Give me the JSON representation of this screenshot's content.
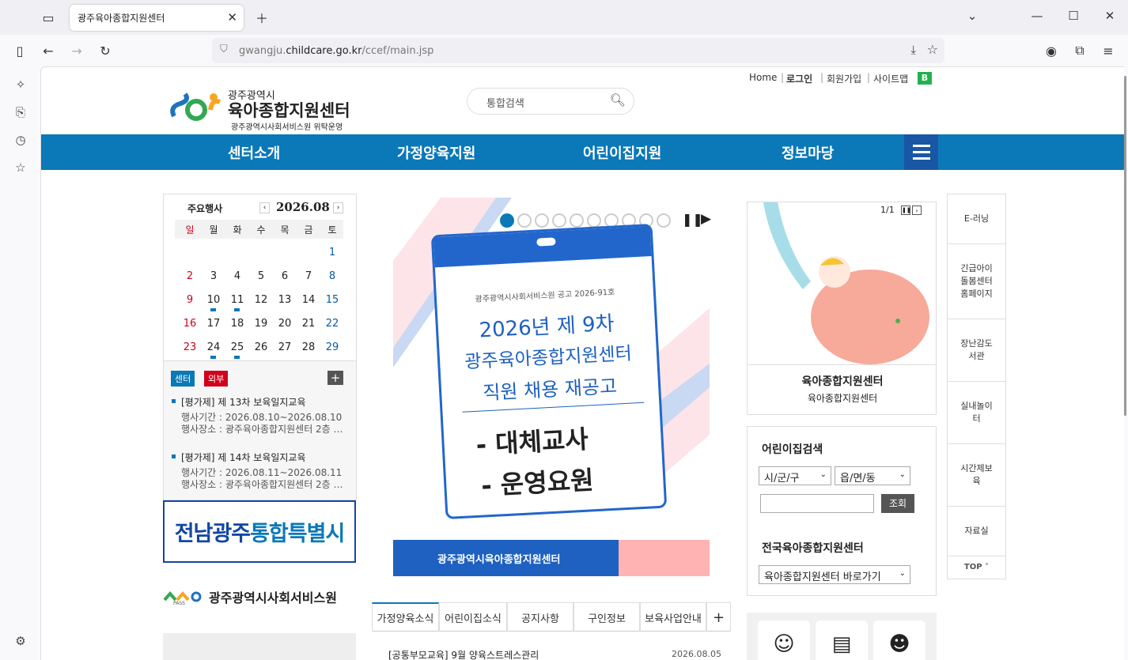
{
  "browser": {
    "tab_title": "광주육아종합지원센터",
    "url_domain": "gwangju.childcare.go.kr",
    "url_path": "/ccef/main.jsp",
    "prefix": "gwangju.",
    "domain": "childcare.go.kr"
  },
  "util": {
    "home": "Home",
    "login": "로그인",
    "join": "회원가입",
    "sitemap": "사이트맵",
    "b": "B"
  },
  "logo": {
    "city": "광주광역시",
    "name": "육아종합지원센터",
    "sub": "광주광역시사회서비스원 위탁운영"
  },
  "search": {
    "placeholder": "통합검색"
  },
  "gnb": [
    "센터소개",
    "가정양육지원",
    "어린이집지원",
    "정보마당"
  ],
  "calendar": {
    "title": "주요행사",
    "month": "2026.08",
    "dow": [
      "일",
      "월",
      "화",
      "수",
      "목",
      "금",
      "토"
    ],
    "weeks": [
      [
        "",
        "",
        "",
        "",
        "",
        "",
        "1"
      ],
      [
        "2",
        "3",
        "4",
        "5",
        "6",
        "7",
        "8"
      ],
      [
        "9",
        "10",
        "11",
        "12",
        "13",
        "14",
        "15"
      ],
      [
        "16",
        "17",
        "18",
        "19",
        "20",
        "21",
        "22"
      ],
      [
        "23",
        "24",
        "25",
        "26",
        "27",
        "28",
        "29"
      ]
    ]
  },
  "events": {
    "badge_center": "센터",
    "badge_outer": "외부",
    "items": [
      {
        "title": "[평가제] 제 13차 보육일지교육",
        "period": "행사기간 : 2026.08.10~2026.08.10",
        "place": "행사장소 : 광주육아종합지원센터 2층 …"
      },
      {
        "title": "[평가제] 제 14차 보육일지교육",
        "period": "행사기간 : 2026.08.11~2026.08.11",
        "place": "행사장소 : 광주육아종합지원센터 2층 …"
      }
    ]
  },
  "banner_left": {
    "text_a": "전남광주",
    "text_b": "통합특별시"
  },
  "pass": {
    "label": "PASS",
    "text": "광주광역시사회서비스원"
  },
  "promo": {
    "notice": "광주광역시사회서비스원 공고 2026-91호",
    "line1": "2026년 제 9차",
    "line2": "광주육아종합지원센터",
    "line3": "직원 채용 재공고",
    "item1": "- 대체교사",
    "item2": "- 운영요원",
    "footer": "광주광역시육아종합지원센터"
  },
  "tabs": [
    "가정양육소식",
    "어린이집소식",
    "공지사항",
    "구인정보",
    "보육사업안내"
  ],
  "news": [
    {
      "title": "[공통부모교육] 9월 양육스트레스관리",
      "date": "2026.08.05"
    }
  ],
  "ad": {
    "counter": "1/1",
    "title": "육아종합지원센터",
    "sub": "육아종합지원센터"
  },
  "daycare_search": {
    "title": "어린이집검색",
    "sel1": "시/군/구",
    "sel2": "읍/면/동",
    "btn": "조회",
    "title2": "전국육아종합지원센터",
    "sel3": "육아종합지원센터 바로가기"
  },
  "quick": [
    "E-러닝",
    "긴급아이돌봄센터홈페이지",
    "장난감도서관",
    "실내놀이터",
    "시간제보육",
    "자료실"
  ],
  "quick_top": "TOP",
  "colors": {
    "primary": "#0b78b7",
    "nav_menu": "#1957a4",
    "sunday": "#d0021b",
    "saturday": "#0b5aa0"
  }
}
